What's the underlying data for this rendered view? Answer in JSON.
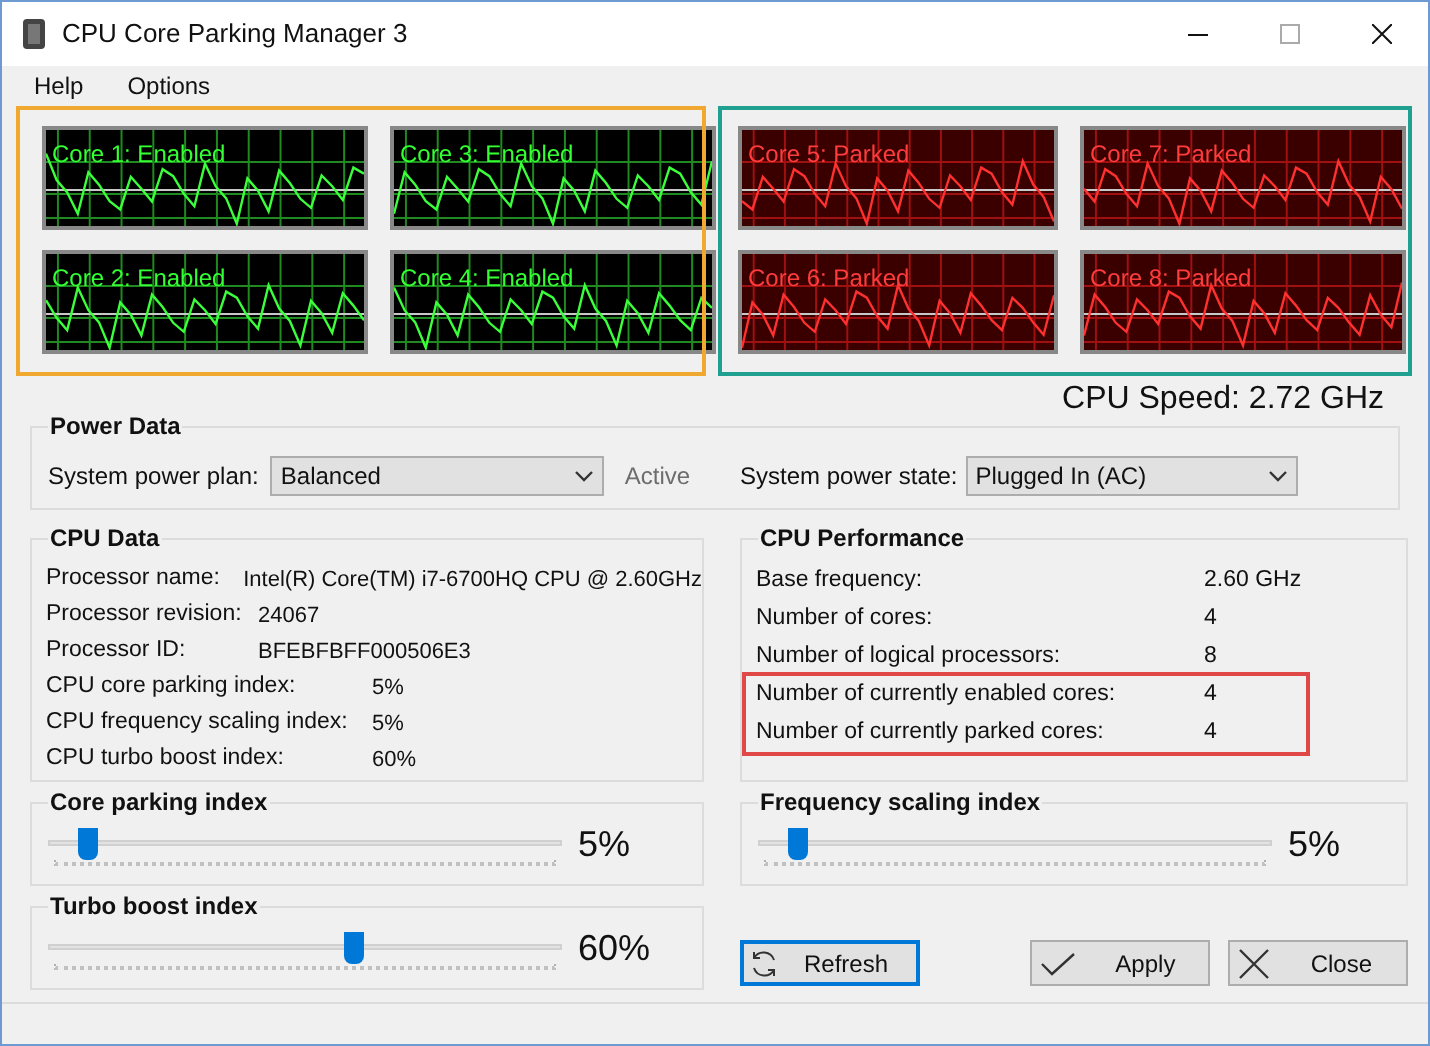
{
  "window": {
    "title": "CPU Core Parking Manager 3"
  },
  "menu": [
    "Help",
    "Options"
  ],
  "cores": [
    {
      "label": "Core 1: Enabled",
      "kind": "enabled"
    },
    {
      "label": "Core 3: Enabled",
      "kind": "enabled"
    },
    {
      "label": "Core 5: Parked",
      "kind": "parked"
    },
    {
      "label": "Core 7: Parked",
      "kind": "parked"
    },
    {
      "label": "Core 2: Enabled",
      "kind": "enabled"
    },
    {
      "label": "Core 4: Enabled",
      "kind": "enabled"
    },
    {
      "label": "Core 6: Parked",
      "kind": "parked"
    },
    {
      "label": "Core 8: Parked",
      "kind": "parked"
    }
  ],
  "cpu_speed": "CPU Speed: 2.72 GHz",
  "power_data": {
    "title": "Power Data",
    "plan_label": "System power plan:",
    "plan_value": "Balanced",
    "plan_status": "Active",
    "state_label": "System power state:",
    "state_value": "Plugged In (AC)"
  },
  "cpu_data": {
    "title": "CPU Data",
    "rows": [
      {
        "label": "Processor name:",
        "value": "Intel(R) Core(TM) i7-6700HQ CPU @ 2.60GHz",
        "kind": "info"
      },
      {
        "label": "Processor revision:",
        "value": "24067",
        "kind": "info"
      },
      {
        "label": "Processor ID:",
        "value": "BFEBFBFF000506E3",
        "kind": "info"
      },
      {
        "label": "CPU core parking index:",
        "value": "5%",
        "kind": "index"
      },
      {
        "label": "CPU frequency scaling index:",
        "value": "5%",
        "kind": "index"
      },
      {
        "label": "CPU turbo boost index:",
        "value": "60%",
        "kind": "index"
      }
    ]
  },
  "cpu_performance": {
    "title": "CPU Performance",
    "rows": [
      {
        "label": "Base frequency:",
        "value": "2.60 GHz"
      },
      {
        "label": "Number of cores:",
        "value": "4"
      },
      {
        "label": "Number of logical processors:",
        "value": "8"
      },
      {
        "label": "Number of currently enabled cores:",
        "value": "4"
      },
      {
        "label": "Number of currently parked cores:",
        "value": "4"
      }
    ]
  },
  "sliders": [
    {
      "title": "Core parking index",
      "level": 0.05,
      "reading": "5%"
    },
    {
      "title": "Frequency scaling index",
      "level": 0.05,
      "reading": "5%"
    },
    {
      "title": "Turbo boost index",
      "level": 0.6,
      "reading": "60%"
    }
  ],
  "buttons": {
    "refresh": "Refresh",
    "apply": "Apply",
    "close": "Close"
  }
}
